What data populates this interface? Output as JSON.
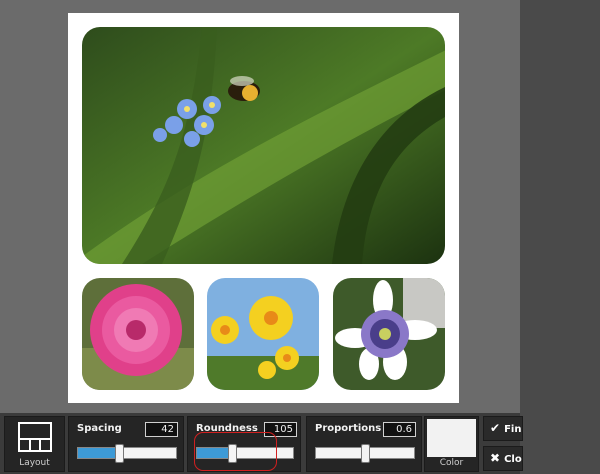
{
  "canvas": {
    "background": "#ffffff",
    "photos": [
      {
        "icon": "forget-me-not-bee-photo"
      },
      {
        "icon": "pink-dahlia-photo"
      },
      {
        "icon": "yellow-daffodils-photo"
      },
      {
        "icon": "passion-flower-photo"
      }
    ]
  },
  "toolbar": {
    "layout": {
      "caption": "Layout",
      "icon": "layout-grid-icon"
    },
    "spacing": {
      "label": "Spacing",
      "value": "42",
      "fraction": 0.42
    },
    "roundness": {
      "label": "Roundness",
      "value": "105",
      "fraction": 0.36
    },
    "proportions": {
      "label": "Proportions",
      "value": "0.6",
      "fraction": 0.5
    },
    "color": {
      "caption": "Color",
      "swatch": "#f2f2f2"
    },
    "finish": {
      "label": "Fin",
      "icon": "checkmark-icon"
    },
    "close": {
      "label": "Clo",
      "icon": "close-icon"
    },
    "accent": "#3d9ad6"
  }
}
